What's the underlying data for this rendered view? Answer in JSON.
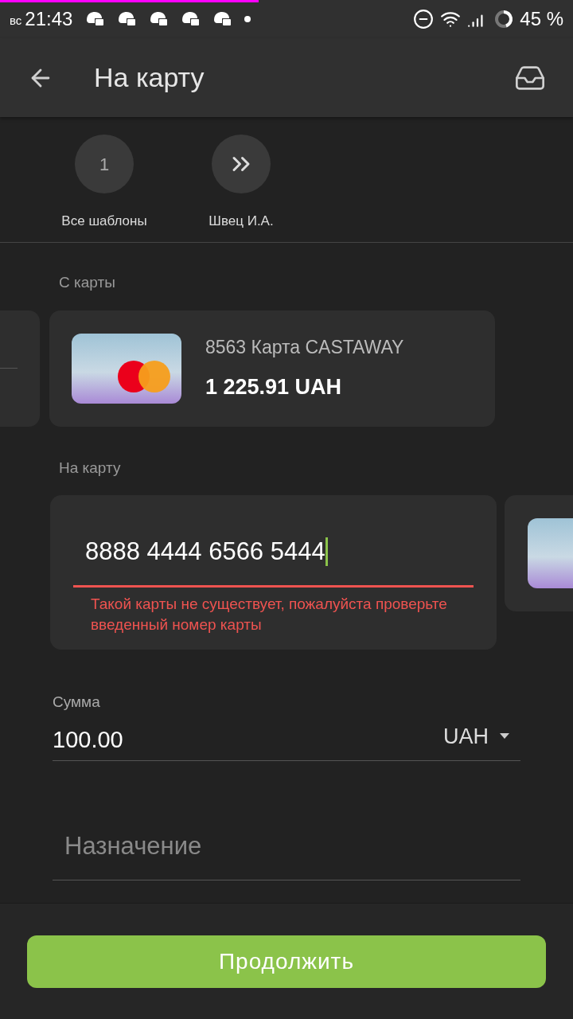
{
  "status_bar": {
    "day": "вс",
    "time": "21:43",
    "battery": "45 %"
  },
  "app_bar": {
    "title": "На карту"
  },
  "templates": [
    {
      "kind": "number",
      "badge": "1",
      "label": "Все шаблоны"
    },
    {
      "kind": "arrows",
      "label": "Швец И.А."
    }
  ],
  "from_card": {
    "label": "С карты",
    "name": "8563 Карта CASTAWAY",
    "balance": "1 225.91 UAH"
  },
  "to_card": {
    "label": "На карту",
    "value": "8888 4444 6566 5444",
    "error": "Такой карты не существует, пожалуйста проверьте введенный номер карты"
  },
  "amount": {
    "label": "Сумма",
    "value": "100.00",
    "currency": "UAH"
  },
  "purpose": {
    "placeholder": "Назначение"
  },
  "continue_button": "Продолжить"
}
